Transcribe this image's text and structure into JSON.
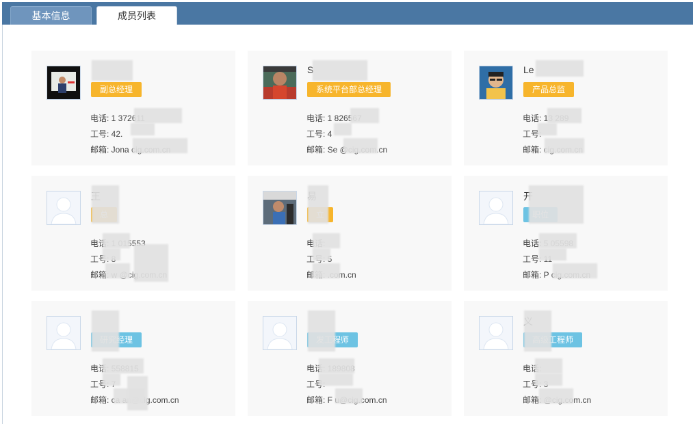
{
  "tabs": [
    {
      "label": "基本信息",
      "active": false
    },
    {
      "label": "成员列表",
      "active": true
    }
  ],
  "colors": {
    "header": "#4a77a3",
    "badge_orange": "#f7b52c",
    "badge_blue": "#6dc3e3",
    "card_bg": "#f8f8f8"
  },
  "labels": {
    "phone": "电话: ",
    "empno": "工号: ",
    "email": "邮箱: "
  },
  "members": [
    {
      "name": "",
      "title": "副总经理",
      "badge": "orange",
      "phone": "1    372611",
      "empno": "42.",
      "email": "Jona          cig.com.cn",
      "avatar": "photo-1"
    },
    {
      "name": "S",
      "title": "系统平台部总经理",
      "badge": "orange",
      "phone": "1    826567",
      "empno": "4",
      "email": "Se     @cig.com.cn",
      "avatar": "photo-2"
    },
    {
      "name": "Le",
      "title": "产品总监",
      "badge": "orange",
      "phone": "13       289",
      "empno": "",
      "email": "         cig.com.cn",
      "avatar": "photo-3"
    },
    {
      "name": "王",
      "title": "总",
      "badge": "orange",
      "phone": "1     015553",
      "empno": "8",
      "email": "w     @cig.com.cn",
      "avatar": "default"
    },
    {
      "name": "易",
      "title": "立",
      "badge": "orange",
      "phone": "",
      "empno": "5",
      "email": "      .com.cn",
      "avatar": "photo-4"
    },
    {
      "name": "开",
      "title": "职位",
      "badge": "blue",
      "phone": "5     05598",
      "empno": "11",
      "email": "P          cig.com.cn",
      "avatar": "default"
    },
    {
      "name": "",
      "title": "研究经理",
      "badge": "blue",
      "phone": "     558815",
      "empno": "7",
      "email": "ca     an@cig.com.cn",
      "avatar": "default"
    },
    {
      "name": "",
      "title": "发工程师",
      "badge": "blue",
      "phone": "     189808",
      "empno": "",
      "email": "F     u@cig.com.cn",
      "avatar": "default"
    },
    {
      "name": "义",
      "title": "高级工程师",
      "badge": "blue",
      "phone": "",
      "empno": "3",
      "email": "       @cig.com.cn",
      "avatar": "default"
    }
  ]
}
